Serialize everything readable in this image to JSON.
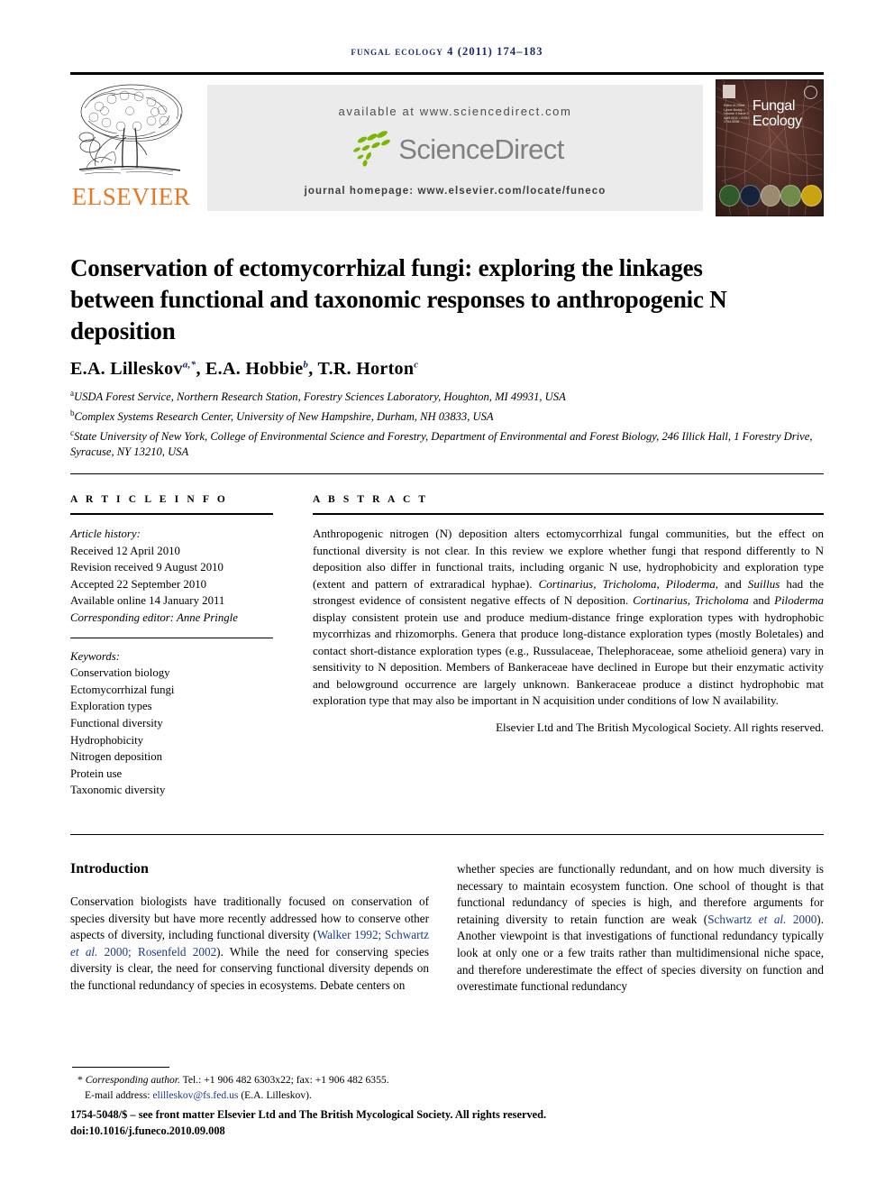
{
  "running_head": "Fungal Ecology 4 (2011) 174–183",
  "masthead": {
    "available_at": "available at www.sciencedirect.com",
    "sciencedirect_wordmark": "ScienceDirect",
    "journal_homepage": "journal homepage: www.elsevier.com/locate/funeco",
    "publisher_name": "ELSEVIER",
    "publisher_logo_icon": "elsevier-tree-icon",
    "cover": {
      "title_line1": "Fungal",
      "title_line2": "Ecology",
      "sidebar_text": "Editor-in-Chief Lynne Boddy • Volume 4 Issue 2 April 2011 • ISSN 1754-5048",
      "badge_icon": "journal-society-emblem-icon",
      "corner_icon": "elsevier-mark-icon"
    },
    "colors": {
      "elsevier_orange": "#E87722",
      "sciencedirect_green": "#7AB800",
      "sciencedirect_gray": "#808080",
      "band_gray": "#EBEBEB",
      "running_head_blue": "#1B2A6B",
      "cover_brown": "#3B2420"
    }
  },
  "article": {
    "title": "Conservation of ectomycorrhizal fungi: exploring the linkages between functional and taxonomic responses to anthropogenic N deposition",
    "authors": [
      {
        "name": "E.A. Lilleskov",
        "marks": "a,*"
      },
      {
        "name": "E.A. Hobbie",
        "marks": "b"
      },
      {
        "name": "T.R. Horton",
        "marks": "c"
      }
    ],
    "affiliations": [
      {
        "mark": "a",
        "text": "USDA Forest Service, Northern Research Station, Forestry Sciences Laboratory, Houghton, MI 49931, USA"
      },
      {
        "mark": "b",
        "text": "Complex Systems Research Center, University of New Hampshire, Durham, NH 03833, USA"
      },
      {
        "mark": "c",
        "text": "State University of New York, College of Environmental Science and Forestry, Department of Environmental and Forest Biology, 246 Illick Hall, 1 Forestry Drive, Syracuse, NY 13210, USA"
      }
    ]
  },
  "article_info": {
    "heading": "A R T I C L E    I N F O",
    "history_label": "Article history:",
    "history": [
      "Received 12 April 2010",
      "Revision received 9 August 2010",
      "Accepted 22 September 2010",
      "Available online 14 January 2011"
    ],
    "corresponding_editor": "Corresponding editor: Anne Pringle",
    "keywords_label": "Keywords:",
    "keywords": [
      "Conservation biology",
      "Ectomycorrhizal fungi",
      "Exploration types",
      "Functional diversity",
      "Hydrophobicity",
      "Nitrogen deposition",
      "Protein use",
      "Taxonomic diversity"
    ]
  },
  "abstract": {
    "heading": "A B S T R A C T",
    "copyright": "Elsevier Ltd and The British Mycological Society. All rights reserved."
  },
  "body": {
    "intro_heading": "Introduction",
    "right_col_para": "whether species are functionally redundant, and on how much diversity is necessary to maintain ecosystem function. One school of thought is that functional redundancy of species is high, and therefore arguments for retaining diversity to retain function are weak ("
  },
  "footnote": {
    "corresponding_author_label": "Corresponding author.",
    "contact": " Tel.: +1 906 482 6303x22; fax: +1 906 482 6355.",
    "email_label": "E-mail address:",
    "email": "elilleskov@fs.fed.us",
    "email_owner": "(E.A. Lilleskov).",
    "front_matter": "1754-5048/$ – see front matter Elsevier Ltd and The British Mycological Society. All rights reserved.",
    "doi": "doi:10.1016/j.funeco.2010.09.008"
  }
}
